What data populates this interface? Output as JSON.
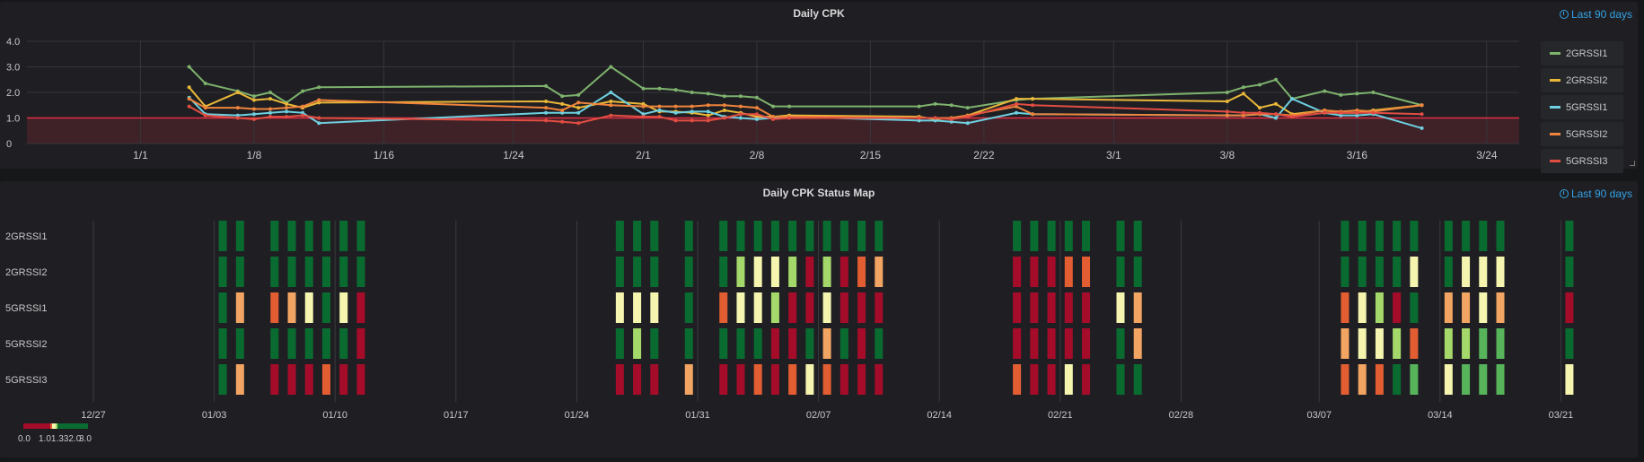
{
  "chart_panel": {
    "title": "Daily CPK",
    "time_range": "Last 90 days",
    "y_ticks": [
      "4.0",
      "3.0",
      "2.0",
      "1.0",
      "0"
    ],
    "x_ticks": [
      "1/1",
      "1/8",
      "1/16",
      "1/24",
      "2/1",
      "2/8",
      "2/15",
      "2/22",
      "3/1",
      "3/8",
      "3/16",
      "3/24"
    ],
    "threshold": 1.0,
    "threshold_color": "#e02f44"
  },
  "chart_data": {
    "type": "line",
    "ylim": [
      0,
      4
    ],
    "xlim": [
      "2019-12-25",
      "2020-03-26"
    ],
    "series": [
      {
        "name": "2GRSSI1",
        "color": "#7eb26d",
        "points": [
          [
            "2020-01-04",
            3.0
          ],
          [
            "2020-01-05",
            2.35
          ],
          [
            "2020-01-07",
            2.05
          ],
          [
            "2020-01-08",
            1.85
          ],
          [
            "2020-01-09",
            2.0
          ],
          [
            "2020-01-10",
            1.6
          ],
          [
            "2020-01-11",
            2.05
          ],
          [
            "2020-01-12",
            2.2
          ],
          [
            "2020-01-26",
            2.25
          ],
          [
            "2020-01-27",
            1.85
          ],
          [
            "2020-01-28",
            1.9
          ],
          [
            "2020-01-30",
            3.0
          ],
          [
            "2020-02-01",
            2.15
          ],
          [
            "2020-02-02",
            2.15
          ],
          [
            "2020-02-03",
            2.1
          ],
          [
            "2020-02-04",
            2.0
          ],
          [
            "2020-02-05",
            1.95
          ],
          [
            "2020-02-06",
            1.85
          ],
          [
            "2020-02-07",
            1.85
          ],
          [
            "2020-02-08",
            1.8
          ],
          [
            "2020-02-09",
            1.45
          ],
          [
            "2020-02-10",
            1.45
          ],
          [
            "2020-02-18",
            1.45
          ],
          [
            "2020-02-19",
            1.55
          ],
          [
            "2020-02-20",
            1.5
          ],
          [
            "2020-02-21",
            1.4
          ],
          [
            "2020-02-24",
            1.7
          ],
          [
            "2020-02-25",
            1.75
          ],
          [
            "2020-03-08",
            2.0
          ],
          [
            "2020-03-09",
            2.2
          ],
          [
            "2020-03-10",
            2.3
          ],
          [
            "2020-03-11",
            2.5
          ],
          [
            "2020-03-12",
            1.75
          ],
          [
            "2020-03-14",
            2.05
          ],
          [
            "2020-03-15",
            1.9
          ],
          [
            "2020-03-16",
            1.95
          ],
          [
            "2020-03-17",
            2.0
          ],
          [
            "2020-03-20",
            1.5
          ]
        ]
      },
      {
        "name": "2GRSSI2",
        "color": "#eab839",
        "points": [
          [
            "2020-01-04",
            2.2
          ],
          [
            "2020-01-05",
            1.45
          ],
          [
            "2020-01-07",
            2.0
          ],
          [
            "2020-01-08",
            1.7
          ],
          [
            "2020-01-09",
            1.75
          ],
          [
            "2020-01-10",
            1.55
          ],
          [
            "2020-01-11",
            1.4
          ],
          [
            "2020-01-12",
            1.6
          ],
          [
            "2020-01-26",
            1.65
          ],
          [
            "2020-01-27",
            1.55
          ],
          [
            "2020-01-28",
            1.4
          ],
          [
            "2020-01-30",
            1.65
          ],
          [
            "2020-02-01",
            1.55
          ],
          [
            "2020-02-02",
            1.25
          ],
          [
            "2020-02-03",
            1.25
          ],
          [
            "2020-02-04",
            1.2
          ],
          [
            "2020-02-05",
            1.1
          ],
          [
            "2020-02-06",
            1.3
          ],
          [
            "2020-02-07",
            1.2
          ],
          [
            "2020-02-08",
            1.05
          ],
          [
            "2020-02-09",
            1.05
          ],
          [
            "2020-02-10",
            1.1
          ],
          [
            "2020-02-18",
            1.05
          ],
          [
            "2020-02-19",
            0.95
          ],
          [
            "2020-02-20",
            1.0
          ],
          [
            "2020-02-21",
            1.1
          ],
          [
            "2020-02-24",
            1.75
          ],
          [
            "2020-02-25",
            1.75
          ],
          [
            "2020-03-08",
            1.65
          ],
          [
            "2020-03-09",
            1.95
          ],
          [
            "2020-03-10",
            1.4
          ],
          [
            "2020-03-11",
            1.55
          ],
          [
            "2020-03-12",
            1.15
          ],
          [
            "2020-03-14",
            1.3
          ],
          [
            "2020-03-15",
            1.2
          ],
          [
            "2020-03-16",
            1.2
          ],
          [
            "2020-03-17",
            1.3
          ],
          [
            "2020-03-20",
            1.5
          ]
        ]
      },
      {
        "name": "5GRSSI1",
        "color": "#6ed0e0",
        "points": [
          [
            "2020-01-04",
            1.8
          ],
          [
            "2020-01-05",
            1.15
          ],
          [
            "2020-01-07",
            1.1
          ],
          [
            "2020-01-08",
            1.15
          ],
          [
            "2020-01-09",
            1.2
          ],
          [
            "2020-01-10",
            1.25
          ],
          [
            "2020-01-11",
            1.2
          ],
          [
            "2020-01-12",
            0.8
          ],
          [
            "2020-01-26",
            1.2
          ],
          [
            "2020-01-27",
            1.2
          ],
          [
            "2020-01-28",
            1.2
          ],
          [
            "2020-01-30",
            2.0
          ],
          [
            "2020-02-01",
            1.15
          ],
          [
            "2020-02-02",
            1.3
          ],
          [
            "2020-02-03",
            1.2
          ],
          [
            "2020-02-04",
            1.25
          ],
          [
            "2020-02-05",
            1.25
          ],
          [
            "2020-02-06",
            1.05
          ],
          [
            "2020-02-07",
            1.0
          ],
          [
            "2020-02-08",
            0.95
          ],
          [
            "2020-02-09",
            1.0
          ],
          [
            "2020-02-10",
            1.05
          ],
          [
            "2020-02-18",
            0.9
          ],
          [
            "2020-02-19",
            0.9
          ],
          [
            "2020-02-20",
            0.85
          ],
          [
            "2020-02-21",
            0.8
          ],
          [
            "2020-02-24",
            1.2
          ],
          [
            "2020-02-25",
            1.15
          ],
          [
            "2020-03-08",
            1.1
          ],
          [
            "2020-03-09",
            1.1
          ],
          [
            "2020-03-10",
            1.15
          ],
          [
            "2020-03-11",
            1.0
          ],
          [
            "2020-03-12",
            1.75
          ],
          [
            "2020-03-14",
            1.2
          ],
          [
            "2020-03-15",
            1.1
          ],
          [
            "2020-03-16",
            1.1
          ],
          [
            "2020-03-17",
            1.15
          ],
          [
            "2020-03-20",
            0.6
          ]
        ]
      },
      {
        "name": "5GRSSI2",
        "color": "#ef843c",
        "points": [
          [
            "2020-01-04",
            1.75
          ],
          [
            "2020-01-05",
            1.4
          ],
          [
            "2020-01-07",
            1.4
          ],
          [
            "2020-01-08",
            1.35
          ],
          [
            "2020-01-09",
            1.35
          ],
          [
            "2020-01-10",
            1.4
          ],
          [
            "2020-01-11",
            1.45
          ],
          [
            "2020-01-12",
            1.7
          ],
          [
            "2020-01-26",
            1.4
          ],
          [
            "2020-01-27",
            1.3
          ],
          [
            "2020-01-28",
            1.6
          ],
          [
            "2020-01-30",
            1.5
          ],
          [
            "2020-02-01",
            1.45
          ],
          [
            "2020-02-02",
            1.45
          ],
          [
            "2020-02-03",
            1.45
          ],
          [
            "2020-02-04",
            1.45
          ],
          [
            "2020-02-05",
            1.5
          ],
          [
            "2020-02-06",
            1.5
          ],
          [
            "2020-02-07",
            1.45
          ],
          [
            "2020-02-08",
            1.4
          ],
          [
            "2020-02-09",
            1.05
          ],
          [
            "2020-02-10",
            1.05
          ],
          [
            "2020-02-18",
            1.0
          ],
          [
            "2020-02-19",
            1.0
          ],
          [
            "2020-02-20",
            1.0
          ],
          [
            "2020-02-21",
            1.1
          ],
          [
            "2020-02-24",
            1.45
          ],
          [
            "2020-02-25",
            1.15
          ],
          [
            "2020-03-08",
            1.1
          ],
          [
            "2020-03-09",
            1.1
          ],
          [
            "2020-03-10",
            1.15
          ],
          [
            "2020-03-11",
            1.15
          ],
          [
            "2020-03-12",
            1.1
          ],
          [
            "2020-03-14",
            1.3
          ],
          [
            "2020-03-15",
            1.25
          ],
          [
            "2020-03-16",
            1.3
          ],
          [
            "2020-03-17",
            1.25
          ],
          [
            "2020-03-20",
            1.5
          ]
        ]
      },
      {
        "name": "5GRSSI3",
        "color": "#e24d42",
        "points": [
          [
            "2020-01-04",
            1.45
          ],
          [
            "2020-01-05",
            1.1
          ],
          [
            "2020-01-07",
            1.0
          ],
          [
            "2020-01-08",
            0.95
          ],
          [
            "2020-01-09",
            1.05
          ],
          [
            "2020-01-10",
            1.05
          ],
          [
            "2020-01-11",
            1.1
          ],
          [
            "2020-01-12",
            1.0
          ],
          [
            "2020-01-26",
            0.9
          ],
          [
            "2020-01-27",
            0.85
          ],
          [
            "2020-01-28",
            0.8
          ],
          [
            "2020-01-30",
            1.1
          ],
          [
            "2020-02-01",
            1.05
          ],
          [
            "2020-02-02",
            1.05
          ],
          [
            "2020-02-03",
            0.9
          ],
          [
            "2020-02-04",
            0.9
          ],
          [
            "2020-02-05",
            0.9
          ],
          [
            "2020-02-06",
            1.0
          ],
          [
            "2020-02-07",
            1.15
          ],
          [
            "2020-02-08",
            1.15
          ],
          [
            "2020-02-09",
            0.95
          ],
          [
            "2020-02-10",
            1.0
          ],
          [
            "2020-02-18",
            1.0
          ],
          [
            "2020-02-19",
            1.0
          ],
          [
            "2020-02-20",
            0.95
          ],
          [
            "2020-02-21",
            1.05
          ],
          [
            "2020-02-24",
            1.55
          ],
          [
            "2020-02-25",
            1.5
          ],
          [
            "2020-03-08",
            1.25
          ],
          [
            "2020-03-09",
            1.2
          ],
          [
            "2020-03-10",
            1.2
          ],
          [
            "2020-03-11",
            1.15
          ],
          [
            "2020-03-12",
            1.05
          ],
          [
            "2020-03-14",
            1.2
          ],
          [
            "2020-03-15",
            1.2
          ],
          [
            "2020-03-16",
            1.2
          ],
          [
            "2020-03-17",
            1.2
          ],
          [
            "2020-03-20",
            1.15
          ]
        ]
      }
    ]
  },
  "status_panel": {
    "title": "Daily CPK Status Map",
    "time_range": "Last 90 days",
    "row_labels": [
      "2GRSSI1",
      "2GRSSI2",
      "5GRSSI1",
      "5GRSSI2",
      "5GRSSI3"
    ],
    "x_ticks": [
      "12/27",
      "01/03",
      "01/10",
      "01/17",
      "01/24",
      "01/31",
      "02/07",
      "02/14",
      "02/21",
      "02/28",
      "03/07",
      "03/14",
      "03/21"
    ],
    "colors": {
      "d": "#0a6b30",
      "g": "#57b45a",
      "l": "#a5d86a",
      "y": "#f5f5b0",
      "o": "#f2a462",
      "r": "#e35d32",
      "c": "#a50c2a"
    },
    "columns": [
      {
        "date": "2020-01-03",
        "cells": "ddddd"
      },
      {
        "date": "2020-01-04",
        "cells": "ddodo"
      },
      {
        "date": "2020-01-06",
        "cells": "ddrdc"
      },
      {
        "date": "2020-01-07",
        "cells": "ddodc"
      },
      {
        "date": "2020-01-08",
        "cells": "ddydc"
      },
      {
        "date": "2020-01-09",
        "cells": "ddddr"
      },
      {
        "date": "2020-01-10",
        "cells": "ddydc"
      },
      {
        "date": "2020-01-11",
        "cells": "ddccc"
      },
      {
        "date": "2020-01-26",
        "cells": "ddydc"
      },
      {
        "date": "2020-01-27",
        "cells": "ddylc"
      },
      {
        "date": "2020-01-28",
        "cells": "ddydc"
      },
      {
        "date": "2020-01-30",
        "cells": "ddddo"
      },
      {
        "date": "2020-02-01",
        "cells": "ddrdc"
      },
      {
        "date": "2020-02-02",
        "cells": "dlydc"
      },
      {
        "date": "2020-02-03",
        "cells": "dyydr"
      },
      {
        "date": "2020-02-04",
        "cells": "dylcc"
      },
      {
        "date": "2020-02-05",
        "cells": "dlccr"
      },
      {
        "date": "2020-02-06",
        "cells": "dccdy"
      },
      {
        "date": "2020-02-07",
        "cells": "dlyor"
      },
      {
        "date": "2020-02-08",
        "cells": "dccdc"
      },
      {
        "date": "2020-02-09",
        "cells": "drccc"
      },
      {
        "date": "2020-02-10",
        "cells": "docdc"
      },
      {
        "date": "2020-02-18",
        "cells": "dcccr"
      },
      {
        "date": "2020-02-19",
        "cells": "dcccc"
      },
      {
        "date": "2020-02-20",
        "cells": "dcccc"
      },
      {
        "date": "2020-02-21",
        "cells": "drccy"
      },
      {
        "date": "2020-02-22",
        "cells": "drccc"
      },
      {
        "date": "2020-02-24",
        "cells": "ddydd"
      },
      {
        "date": "2020-02-25",
        "cells": "ddood"
      },
      {
        "date": "2020-03-08",
        "cells": "ddror"
      },
      {
        "date": "2020-03-09",
        "cells": "ddyyo"
      },
      {
        "date": "2020-03-10",
        "cells": "ddlyr"
      },
      {
        "date": "2020-03-11",
        "cells": "ddcld"
      },
      {
        "date": "2020-03-12",
        "cells": "dydrg"
      },
      {
        "date": "2020-03-14",
        "cells": "ddoly"
      },
      {
        "date": "2020-03-15",
        "cells": "dyolg"
      },
      {
        "date": "2020-03-16",
        "cells": "dyygg"
      },
      {
        "date": "2020-03-17",
        "cells": "dyogg"
      },
      {
        "date": "2020-03-21",
        "cells": "ddcdy"
      }
    ],
    "legend": {
      "min_label": "0.0",
      "mid_labels": [
        "1.0",
        "1.33",
        "2.0"
      ],
      "max_label": "3.0",
      "text": "1.01.332.0"
    }
  }
}
